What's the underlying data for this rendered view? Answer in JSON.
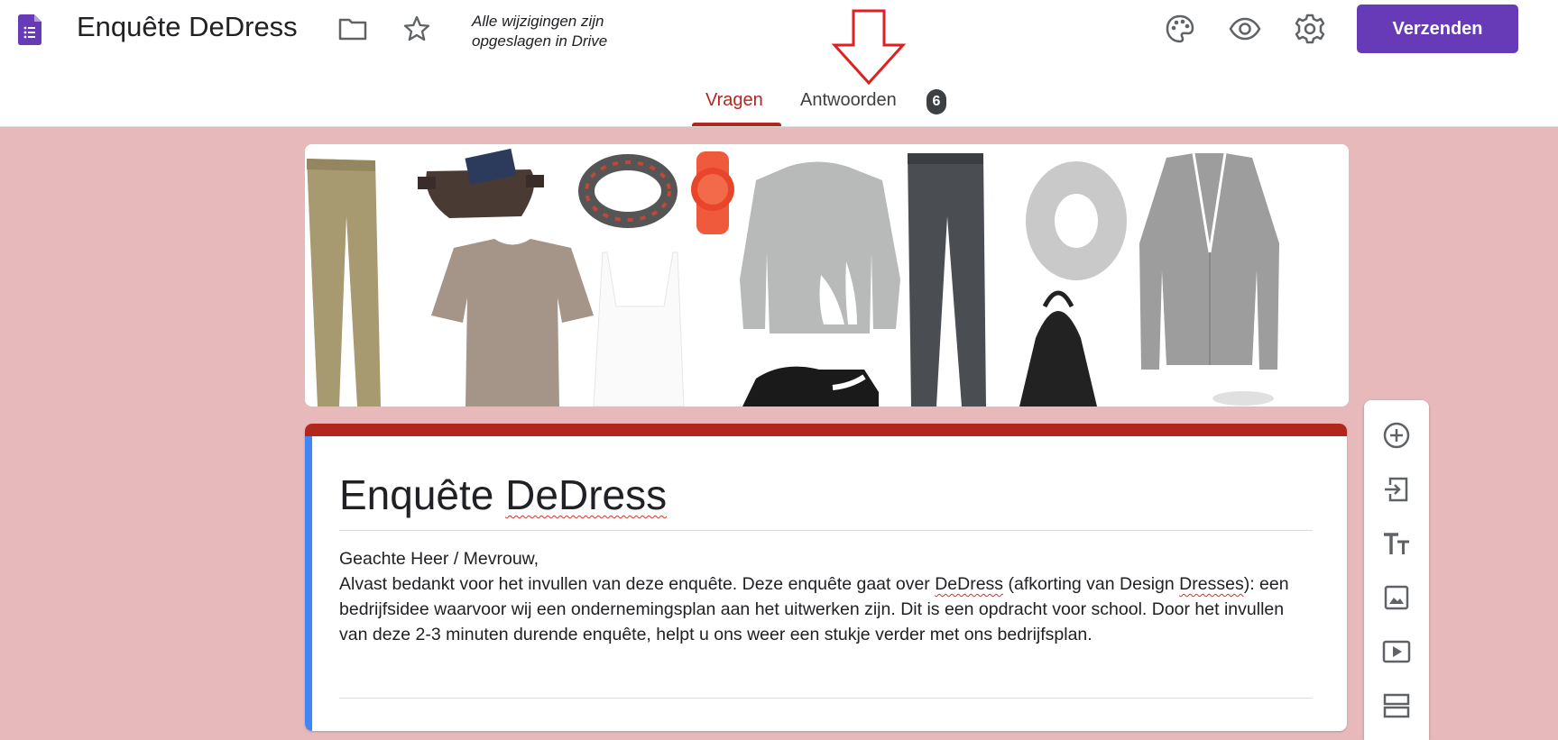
{
  "header": {
    "doc_title": "Enquête DeDress",
    "save_status_line1": "Alle wijzigingen zijn",
    "save_status_line2": "opgeslagen in Drive",
    "send_label": "Verzenden",
    "icons": [
      "forms-app-icon",
      "folder-icon",
      "star-icon",
      "palette-icon",
      "eye-icon",
      "gear-icon"
    ]
  },
  "tabs": {
    "questions_label": "Vragen",
    "responses_label": "Antwoorden",
    "responses_count": "6"
  },
  "form": {
    "title_part1": "Enquête ",
    "title_part2": "DeDress",
    "greeting": "Geachte Heer / Mevrouw,",
    "desc_part1": "Alvast bedankt voor het invullen van deze enquête. Deze enquête gaat over ",
    "desc_link1": "DeDress",
    "desc_part2": " (afkorting van Design ",
    "desc_link2": "Dresses",
    "desc_part3": "): een bedrijfsidee waarvoor wij een ondernemingsplan aan het uitwerken zijn. Dit is een opdracht voor school. Door het invullen van deze 2-3 minuten durende enquête, helpt u ons weer een stukje verder met ons bedrijfsplan."
  },
  "toolbar": {
    "items": [
      "add-question-icon",
      "import-questions-icon",
      "add-title-icon",
      "add-image-icon",
      "add-video-icon",
      "add-section-icon"
    ]
  },
  "colors": {
    "accent": "#673ab7",
    "theme": "#b3261e",
    "background": "#e8b9bb",
    "left_bar": "#4285f4"
  }
}
